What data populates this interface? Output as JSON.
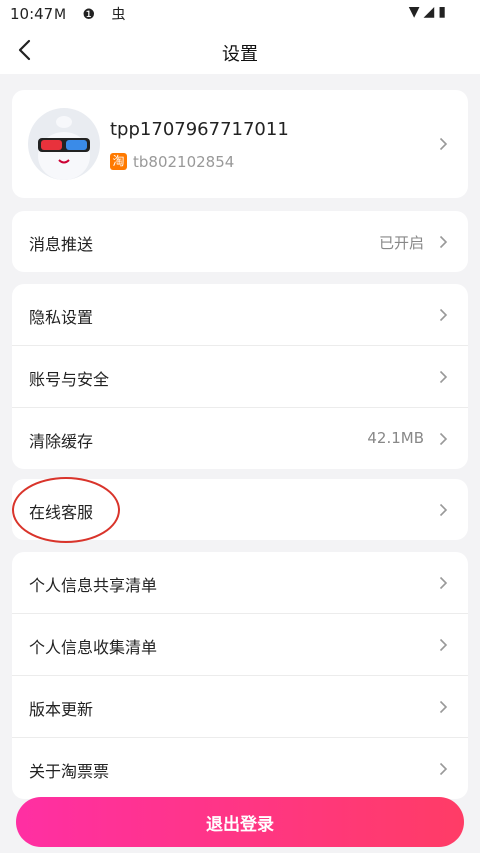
{
  "status_bar": {
    "time": "10:47",
    "left_icons": "M ❶ 虫",
    "right_icons": "▼◢▮"
  },
  "header": {
    "title": "设置"
  },
  "profile": {
    "username": "tpp1707967717011",
    "account_badge": "淘",
    "account_id": "tb802102854"
  },
  "groups": {
    "notifications": [
      {
        "label": "消息推送",
        "value": "已开启"
      }
    ],
    "account": [
      {
        "label": "隐私设置",
        "value": ""
      },
      {
        "label": "账号与安全",
        "value": ""
      },
      {
        "label": "清除缓存",
        "value": "42.1MB"
      }
    ],
    "service": [
      {
        "label": "在线客服",
        "value": ""
      }
    ],
    "info": [
      {
        "label": "个人信息共享清单",
        "value": ""
      },
      {
        "label": "个人信息收集清单",
        "value": ""
      },
      {
        "label": "版本更新",
        "value": ""
      },
      {
        "label": "关于淘票票",
        "value": ""
      }
    ]
  },
  "logout": {
    "label": "退出登录"
  },
  "colors": {
    "accent_start": "#ff2fa3",
    "accent_end": "#ff3c66",
    "annotation": "#d9342b"
  }
}
